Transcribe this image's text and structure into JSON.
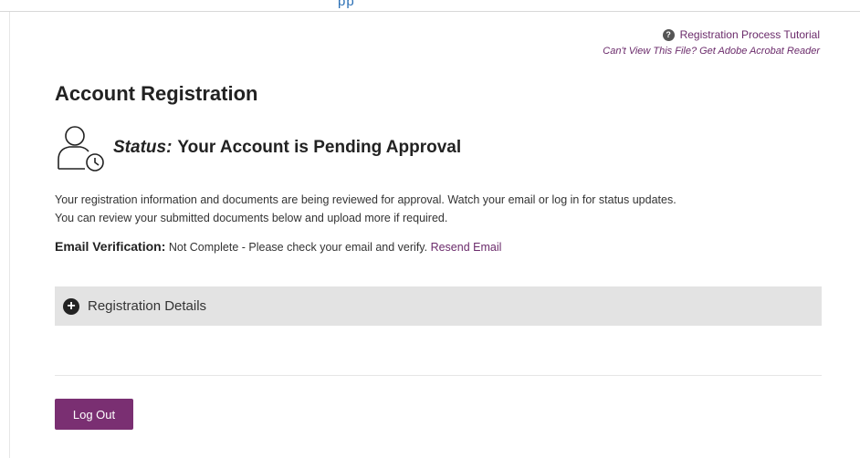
{
  "header": {
    "clipped_text": "pp"
  },
  "links": {
    "tutorial": "Registration Process Tutorial",
    "help_icon": "?",
    "acrobat": "Can't View This File? Get Adobe Acrobat Reader"
  },
  "page": {
    "title": "Account Registration"
  },
  "status": {
    "icon": "user-clock-icon",
    "label": "Status:",
    "text": "Your Account is Pending Approval"
  },
  "info": {
    "line1": "Your registration information and documents are being reviewed for approval. Watch your email or log in for status updates.",
    "line2": "You can review your submitted documents below and upload more if required."
  },
  "verification": {
    "label": "Email Verification:",
    "text": "Not Complete - Please check your email and verify.",
    "resend_link": "Resend Email"
  },
  "details": {
    "label": "Registration Details",
    "icon": "plus-circle-icon"
  },
  "logout_label": "Log Out",
  "colors": {
    "accent": "#7a2f72",
    "link": "#6b2b6b",
    "panel": "#e3e3e3"
  }
}
